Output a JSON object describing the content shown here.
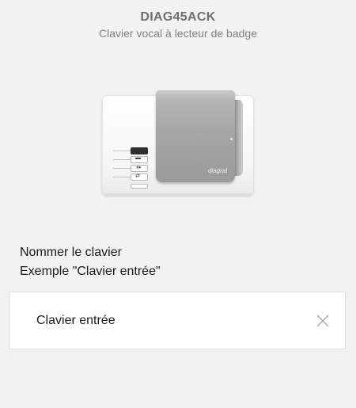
{
  "header": {
    "title": "DIAG45ACK",
    "subtitle": "Clavier vocal à lecteur de badge"
  },
  "device": {
    "image_name": "keypad-badge-reader-image",
    "logo_text": "diagral"
  },
  "form": {
    "label_line1": "Nommer le clavier",
    "label_line2": "Exemple \"Clavier entrée\"",
    "input_value": "Clavier entrée",
    "clear_icon": "close-icon"
  },
  "colors": {
    "background": "#f2f2f2",
    "title": "#6f6f6f",
    "input_background": "#ffffff",
    "input_border": "#dddddd"
  }
}
